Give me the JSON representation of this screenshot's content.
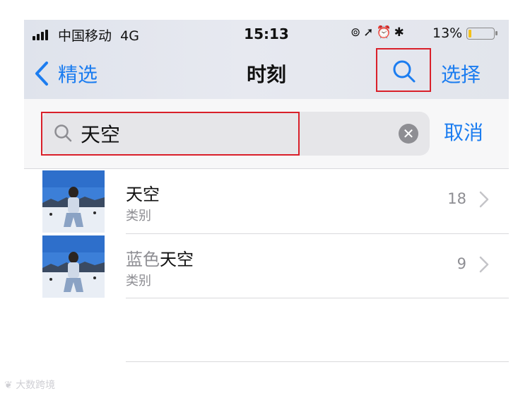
{
  "status_bar": {
    "carrier": "中国移动",
    "network": "4G",
    "time": "15:13",
    "battery": "13%",
    "battery_level": 0.13,
    "icons": [
      "screen-rotation-lock-icon",
      "location-arrow-icon",
      "alarm-icon",
      "bluetooth-icon"
    ]
  },
  "nav": {
    "back_label": "精选",
    "title": "时刻",
    "select_label": "选择",
    "search_icon": "search-icon"
  },
  "search": {
    "value": "天空",
    "cancel_label": "取消",
    "clear_icon": "clear-icon"
  },
  "results": [
    {
      "title_dim": "",
      "title": "天空",
      "subtitle": "类别",
      "count": "18"
    },
    {
      "title_dim": "蓝色",
      "title": "天空",
      "subtitle": "类别",
      "count": "9"
    }
  ],
  "watermark": "大数跨境",
  "colors": {
    "accent": "#1c7df0",
    "highlight": "#d9202a",
    "battery": "#f3c11a"
  }
}
